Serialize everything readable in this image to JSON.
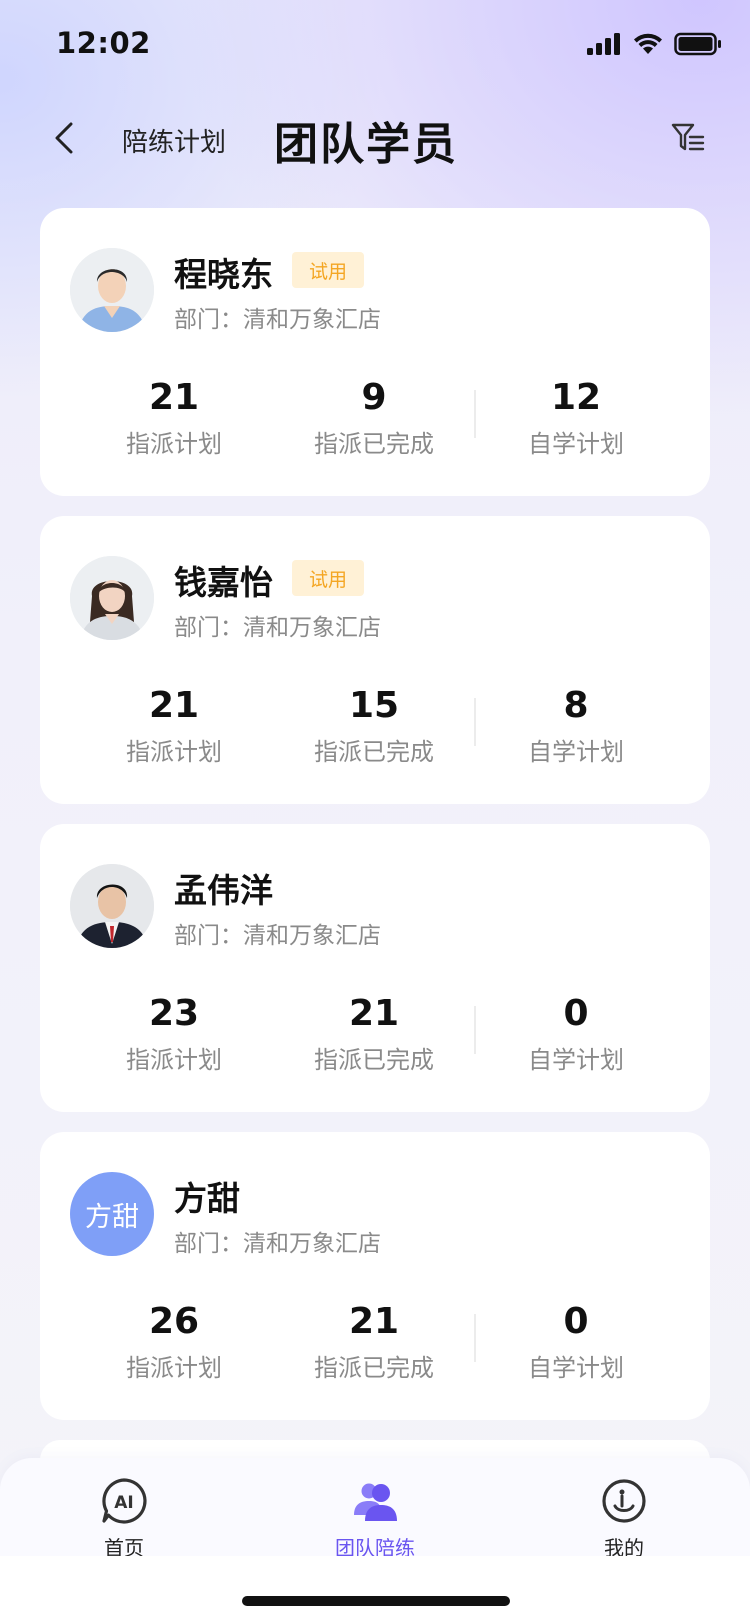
{
  "status_bar": {
    "time": "12:02"
  },
  "nav": {
    "back_label": "陪练计划",
    "title": "团队学员"
  },
  "members": [
    {
      "name": "程晓东",
      "badge": "试用",
      "dept": "部门：清和万象汇店",
      "assigned": "21",
      "assigned_label": "指派计划",
      "completed": "9",
      "completed_label": "指派已完成",
      "self": "12",
      "self_label": "自学计划",
      "avatar_type": "photo-male-1"
    },
    {
      "name": "钱嘉怡",
      "badge": "试用",
      "dept": "部门：清和万象汇店",
      "assigned": "21",
      "assigned_label": "指派计划",
      "completed": "15",
      "completed_label": "指派已完成",
      "self": "8",
      "self_label": "自学计划",
      "avatar_type": "photo-female-1"
    },
    {
      "name": "孟伟洋",
      "badge": "",
      "dept": "部门：清和万象汇店",
      "assigned": "23",
      "assigned_label": "指派计划",
      "completed": "21",
      "completed_label": "指派已完成",
      "self": "0",
      "self_label": "自学计划",
      "avatar_type": "photo-male-2"
    },
    {
      "name": "方甜",
      "badge": "",
      "avatar_text": "方甜",
      "dept": "部门：清和万象汇店",
      "assigned": "26",
      "assigned_label": "指派计划",
      "completed": "21",
      "completed_label": "指派已完成",
      "self": "0",
      "self_label": "自学计划",
      "avatar_type": "text"
    }
  ],
  "tabbar": {
    "tabs": [
      {
        "label": "首页",
        "icon": "ai-home-icon"
      },
      {
        "label": "团队陪练",
        "icon": "team-icon"
      },
      {
        "label": "我的",
        "icon": "profile-icon"
      }
    ],
    "active_color": "#6a55f0"
  },
  "colors": {
    "badge_bg": "#fff1d6",
    "badge_text": "#f4a623",
    "avatar_text_bg": "#7f9ff7"
  }
}
